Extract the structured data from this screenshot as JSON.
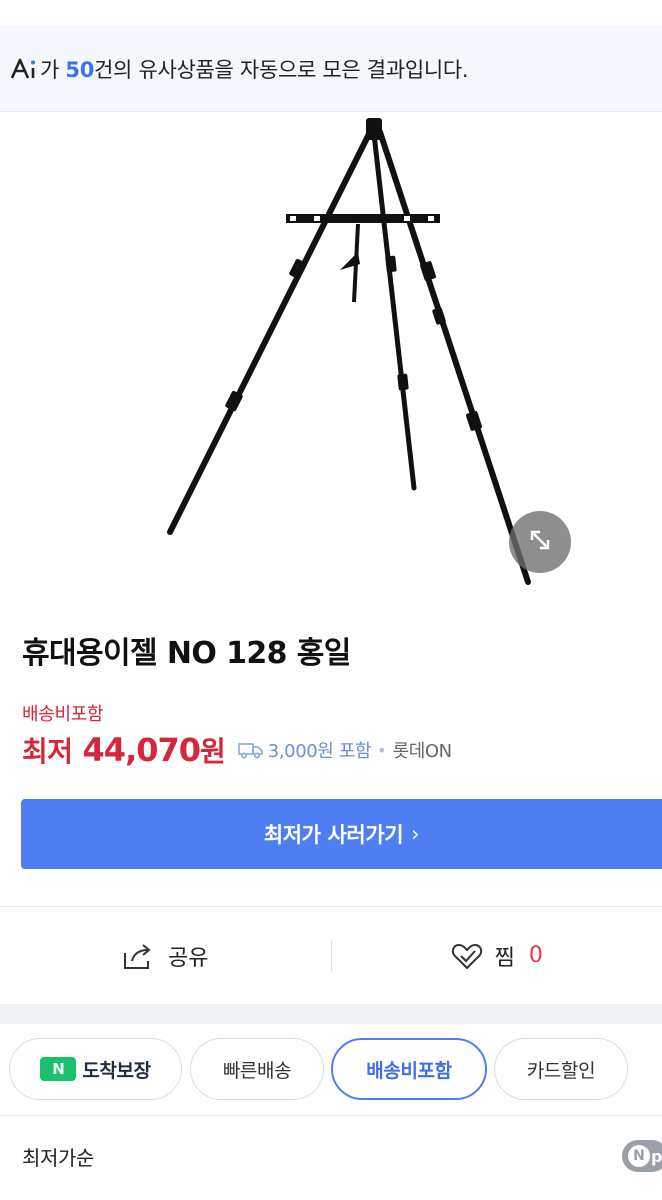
{
  "ai_banner": {
    "logo_text": "Ai",
    "text_before": "가 ",
    "count": "50",
    "text_after": "건의 유사상품을 자동으로 모은 결과입니다."
  },
  "product": {
    "title": "휴대용이젤 NO 128 홍일",
    "image_icon": "easel-image",
    "zoom_icon": "expand-icon"
  },
  "pricing": {
    "shipping_note": "배송비포함",
    "price_prefix": "최저",
    "price_value": "44,070",
    "price_unit": "원",
    "shipping_fee": "3,000원 포함",
    "seller": "롯데ON"
  },
  "buy_button": {
    "label": "최저가 사러가기",
    "chevron": "›"
  },
  "actions": {
    "share_label": "공유",
    "like_label": "찜",
    "like_count": "0"
  },
  "filters": [
    {
      "label": "도착보장",
      "badge": "N",
      "active": false
    },
    {
      "label": "빠른배송",
      "active": false
    },
    {
      "label": "배송비포함",
      "active": true
    },
    {
      "label": "카드할인",
      "active": false
    }
  ],
  "sort": {
    "label": "최저가순"
  },
  "np_badge": {
    "n": "N",
    "p": "p"
  },
  "colors": {
    "accent": "#4f7ef2",
    "price_red": "#d6263b",
    "green_badge": "#17c26b"
  }
}
